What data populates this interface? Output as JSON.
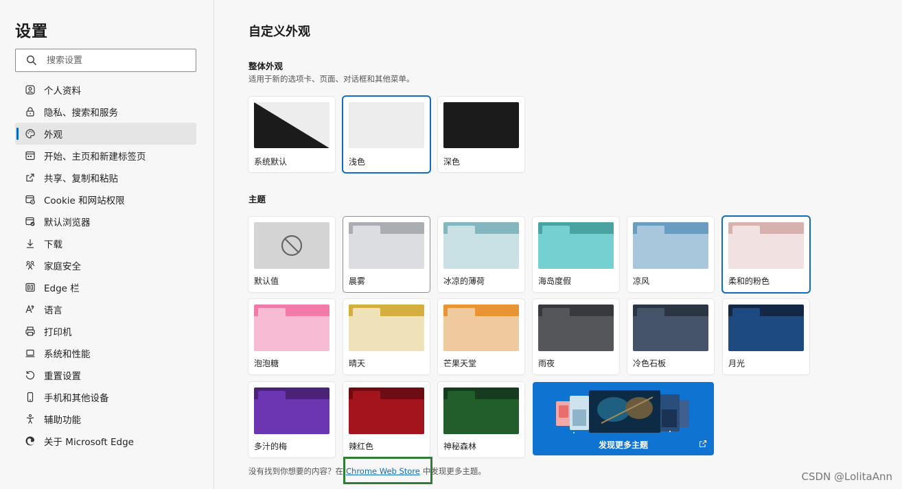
{
  "sidebar": {
    "title": "设置",
    "search_placeholder": "搜索设置",
    "items": [
      {
        "label": "个人资料",
        "icon": "profile-icon"
      },
      {
        "label": "隐私、搜索和服务",
        "icon": "lock-icon"
      },
      {
        "label": "外观",
        "icon": "palette-icon",
        "active": true
      },
      {
        "label": "开始、主页和新建标签页",
        "icon": "start-page-icon"
      },
      {
        "label": "共享、复制和粘贴",
        "icon": "share-icon"
      },
      {
        "label": "Cookie 和网站权限",
        "icon": "cookie-permissions-icon"
      },
      {
        "label": "默认浏览器",
        "icon": "default-browser-icon"
      },
      {
        "label": "下载",
        "icon": "download-icon"
      },
      {
        "label": "家庭安全",
        "icon": "family-icon"
      },
      {
        "label": "Edge 栏",
        "icon": "edge-bar-icon"
      },
      {
        "label": "语言",
        "icon": "language-icon"
      },
      {
        "label": "打印机",
        "icon": "printer-icon"
      },
      {
        "label": "系统和性能",
        "icon": "laptop-icon"
      },
      {
        "label": "重置设置",
        "icon": "reset-icon"
      },
      {
        "label": "手机和其他设备",
        "icon": "phone-icon"
      },
      {
        "label": "辅助功能",
        "icon": "accessibility-icon"
      },
      {
        "label": "关于 Microsoft Edge",
        "icon": "edge-logo-icon"
      }
    ]
  },
  "main": {
    "title": "自定义外观",
    "overall": {
      "title": "整体外观",
      "description": "适用于新的选项卡、页面、对话框和其他菜单。",
      "options": [
        {
          "label": "系统默认"
        },
        {
          "label": "浅色",
          "selected": true
        },
        {
          "label": "深色"
        }
      ]
    },
    "themes": {
      "title": "主题",
      "items": [
        {
          "label": "默认值"
        },
        {
          "label": "晨雾",
          "top": "#aaadb2",
          "tab": "#dcdde1",
          "body": "#dcdde1"
        },
        {
          "label": "冰凉的薄荷",
          "top": "#84b6be",
          "tab": "#c9e0e4",
          "body": "#c9e0e4"
        },
        {
          "label": "海岛度假",
          "top": "#48a3a1",
          "tab": "#75d1d1",
          "body": "#75d1d1"
        },
        {
          "label": "凉风",
          "top": "#6a9cc0",
          "tab": "#a9c7dc",
          "body": "#a9c7dc"
        },
        {
          "label": "柔和的粉色",
          "top": "#d6b1ad",
          "tab": "#f1e1e0",
          "body": "#f1e1e0",
          "selected": true
        },
        {
          "label": "泡泡糖",
          "top": "#f27aa8",
          "tab": "#f7bcd3",
          "body": "#f7bcd3"
        },
        {
          "label": "晴天",
          "top": "#d4ae3f",
          "tab": "#efe2b8",
          "body": "#efe2b8"
        },
        {
          "label": "芒果天堂",
          "top": "#e89433",
          "tab": "#f0ca9f",
          "body": "#f0ca9f"
        },
        {
          "label": "雨夜",
          "top": "#38393c",
          "tab": "#55565a",
          "body": "#55565a"
        },
        {
          "label": "冷色石板",
          "top": "#2c3543",
          "tab": "#46546a",
          "body": "#46546a"
        },
        {
          "label": "月光",
          "top": "#122845",
          "tab": "#1d4a80",
          "body": "#1d4a80"
        },
        {
          "label": "多汁的梅",
          "top": "#4a2378",
          "tab": "#6c36b3",
          "body": "#6c36b3"
        },
        {
          "label": "辣红色",
          "top": "#6d0d13",
          "tab": "#a3141d",
          "body": "#a3141d"
        },
        {
          "label": "神秘森林",
          "top": "#163b1e",
          "tab": "#225e2c",
          "body": "#225e2c"
        }
      ],
      "discover_label": "发现更多主题"
    },
    "footer": {
      "before": "没有找到你想要的内容？在",
      "link": "Chrome Web Store",
      "after": "中发现更多主题。"
    }
  },
  "watermark": "CSDN @LolitaAnn",
  "colors": {
    "accent": "#0f6cbd",
    "discover_bg": "#0f74d1",
    "highlight_box": "#2e7d32"
  }
}
